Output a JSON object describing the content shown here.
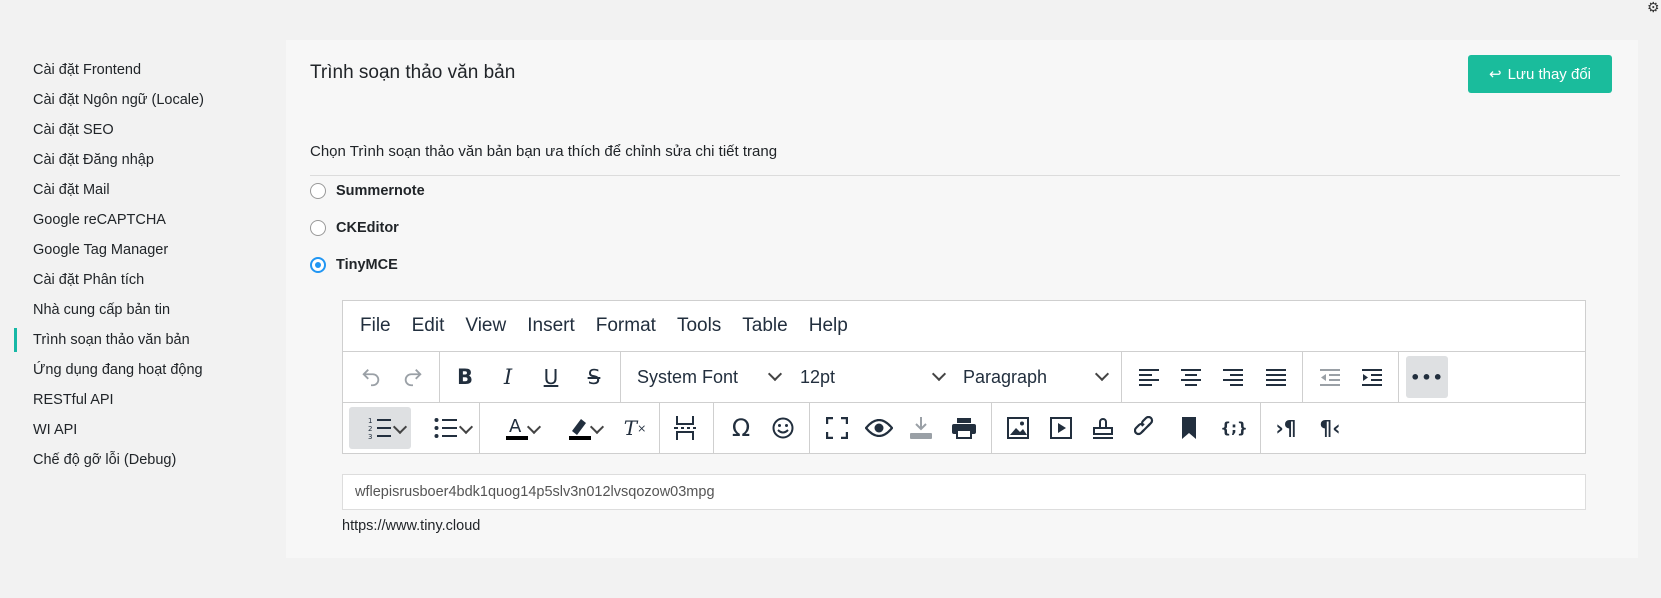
{
  "sidebar": {
    "items": [
      {
        "label": "Cài đặt Frontend"
      },
      {
        "label": "Cài đặt Ngôn ngữ (Locale)"
      },
      {
        "label": "Cài đặt SEO"
      },
      {
        "label": "Cài đặt Đăng nhập"
      },
      {
        "label": "Cài đặt Mail"
      },
      {
        "label": "Google reCAPTCHA"
      },
      {
        "label": "Google Tag Manager"
      },
      {
        "label": "Cài đặt Phân tích"
      },
      {
        "label": "Nhà cung cấp bản tin"
      },
      {
        "label": "Trình soạn thảo văn bản",
        "active": true
      },
      {
        "label": "Ứng dụng đang hoạt động"
      },
      {
        "label": "RESTful API"
      },
      {
        "label": "WI API"
      },
      {
        "label": "Chế độ gỡ lỗi (Debug)"
      }
    ]
  },
  "main": {
    "title": "Trình soạn thảo văn bản",
    "save_label": "Lưu thay đổi",
    "description": "Chọn Trình soạn thảo văn bản bạn ưa thích để chỉnh sửa chi tiết trang",
    "editors": [
      {
        "label": "Summernote",
        "checked": false
      },
      {
        "label": "CKEditor",
        "checked": false
      },
      {
        "label": "TinyMCE",
        "checked": true
      }
    ],
    "api_key": "wflepisrusboer4bdk1quog14p5slv3n012lvsqozow03mpg",
    "url": "https://www.tiny.cloud"
  },
  "tinymce": {
    "menu": [
      "File",
      "Edit",
      "View",
      "Insert",
      "Format",
      "Tools",
      "Table",
      "Help"
    ],
    "font_family": "System Font",
    "font_size": "12pt",
    "block_format": "Paragraph"
  },
  "colors": {
    "accent": "#1abc9c",
    "radio_checked": "#2196f3"
  }
}
